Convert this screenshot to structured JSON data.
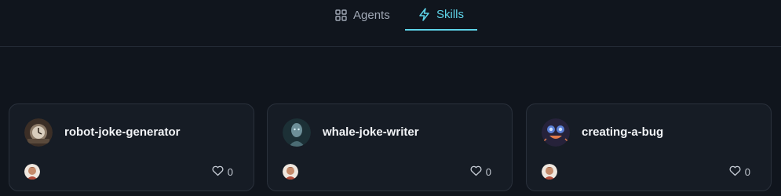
{
  "tabs": [
    {
      "label": "Agents",
      "icon": "grid-icon",
      "active": false
    },
    {
      "label": "Skills",
      "icon": "lightning-icon",
      "active": true
    }
  ],
  "accent_color": "#5ed3e8",
  "cards": [
    {
      "name": "robot-joke-generator",
      "likes": "0",
      "avatar_icon": "robot-clock-avatar"
    },
    {
      "name": "whale-joke-writer",
      "likes": "0",
      "avatar_icon": "cyborg-head-avatar"
    },
    {
      "name": "creating-a-bug",
      "likes": "0",
      "avatar_icon": "bug-robot-avatar"
    }
  ]
}
